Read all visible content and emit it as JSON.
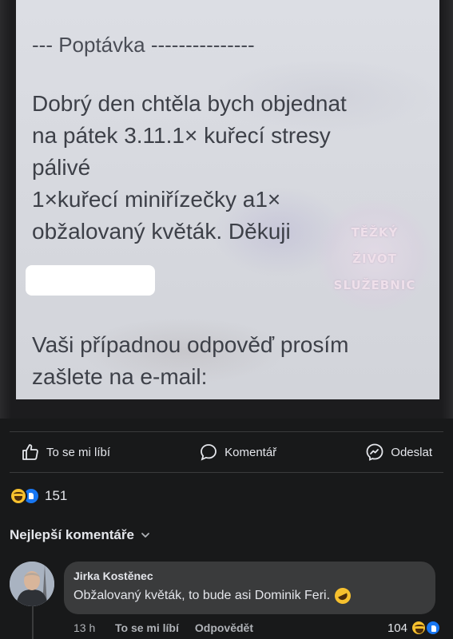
{
  "screenshot": {
    "inquiry_heading": "--- Poptávka ---------------",
    "message_body": "Dobrý den chtěla bych objednat\nna pátek 3.11.1× kuřecí stresy\npálivé\n1×kuřecí miniřízečky a1×\nobžalovaný květák. Děkuji",
    "reply_note": "Vaši případnou odpověď prosím\nzašlete na e-mail:",
    "watermark_text": "TĚŽKÝ\nŽIVOT\nSLUŽEBNIC"
  },
  "actions": {
    "like_label": "To se mi líbí",
    "comment_label": "Komentář",
    "send_label": "Odeslat"
  },
  "reactions": {
    "count": "151",
    "types": [
      "haha",
      "like"
    ]
  },
  "comments_section": {
    "sort_label": "Nejlepší komentáře"
  },
  "comment": {
    "author": "Jirka Kostěnec",
    "text": "Obžalovaný květák, to bude asi Dominik Feri.",
    "emoji": "rolling-on-floor-laughing",
    "time": "13 h",
    "like_label": "To se mi líbí",
    "reply_label": "Odpovědět",
    "reaction_count": "104"
  },
  "colors": {
    "background": "#18191a",
    "bubble": "#3a3b3c",
    "like_blue": "#1877f2",
    "emoji_yellow": "#f7c12e"
  }
}
